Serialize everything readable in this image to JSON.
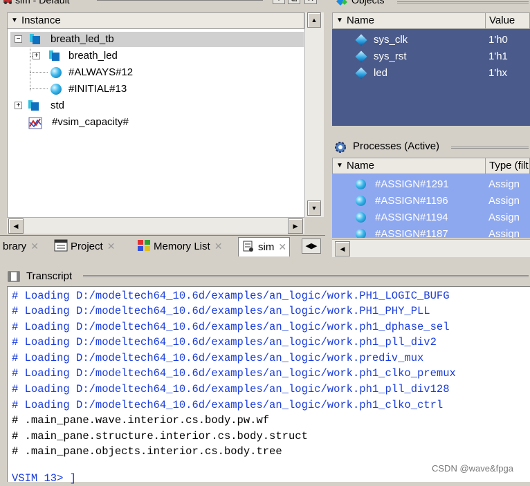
{
  "sim_pane": {
    "title": "sim - Default",
    "column_header": "Instance",
    "tree": [
      {
        "label": "breath_led_tb",
        "kind": "module",
        "expander": "−",
        "selected": true
      },
      {
        "label": "breath_led",
        "kind": "module",
        "expander": "+"
      },
      {
        "label": "#ALWAYS#12",
        "kind": "process"
      },
      {
        "label": "#INITIAL#13",
        "kind": "process"
      },
      {
        "label": "std",
        "kind": "module",
        "expander": "+"
      },
      {
        "label": "#vsim_capacity#",
        "kind": "capacity"
      }
    ]
  },
  "tabs": [
    {
      "label": "brary",
      "icon": "library-icon"
    },
    {
      "label": "Project",
      "icon": "project-icon"
    },
    {
      "label": "Memory List",
      "icon": "memory-icon"
    },
    {
      "label": "sim",
      "icon": "sim-icon",
      "active": true
    }
  ],
  "objects_pane": {
    "title": "Objects",
    "columns": [
      "Name",
      "Value"
    ],
    "rows": [
      {
        "name": "sys_clk",
        "value": "1'h0"
      },
      {
        "name": "sys_rst",
        "value": "1'h1"
      },
      {
        "name": "led",
        "value": "1'hx"
      }
    ]
  },
  "processes_pane": {
    "title": "Processes (Active)",
    "columns": [
      "Name",
      "Type (filt"
    ],
    "rows": [
      {
        "name": "#ASSIGN#1291",
        "type": "Assign"
      },
      {
        "name": "#ASSIGN#1196",
        "type": "Assign"
      },
      {
        "name": "#ASSIGN#1194",
        "type": "Assign"
      },
      {
        "name": "#ASSIGN#1187",
        "type": "Assign"
      }
    ]
  },
  "transcript": {
    "title": "Transcript",
    "lines": [
      {
        "text": "# Loading D:/modeltech64_10.6d/examples/an_logic/work.PH1_LOGIC_BUFG",
        "color": "blue"
      },
      {
        "text": "# Loading D:/modeltech64_10.6d/examples/an_logic/work.PH1_PHY_PLL",
        "color": "blue"
      },
      {
        "text": "# Loading D:/modeltech64_10.6d/examples/an_logic/work.ph1_dphase_sel",
        "color": "blue"
      },
      {
        "text": "# Loading D:/modeltech64_10.6d/examples/an_logic/work.ph1_pll_div2",
        "color": "blue"
      },
      {
        "text": "# Loading D:/modeltech64_10.6d/examples/an_logic/work.prediv_mux",
        "color": "blue"
      },
      {
        "text": "# Loading D:/modeltech64_10.6d/examples/an_logic/work.ph1_clko_premux",
        "color": "blue"
      },
      {
        "text": "# Loading D:/modeltech64_10.6d/examples/an_logic/work.ph1_pll_div128",
        "color": "blue"
      },
      {
        "text": "# Loading D:/modeltech64_10.6d/examples/an_logic/work.ph1_clko_ctrl",
        "color": "blue"
      },
      {
        "text": "# .main_pane.wave.interior.cs.body.pw.wf",
        "color": "black"
      },
      {
        "text": "# .main_pane.structure.interior.cs.body.struct",
        "color": "black"
      },
      {
        "text": "# .main_pane.objects.interior.cs.body.tree",
        "color": "black"
      }
    ],
    "prompt": "VSIM 13> ]"
  },
  "watermark": "CSDN @wave&fpga",
  "colors": {
    "objects_bg": "#4a5a8a",
    "processes_bg": "#8ea8f0",
    "transcript_blue": "#1a3cdc"
  }
}
